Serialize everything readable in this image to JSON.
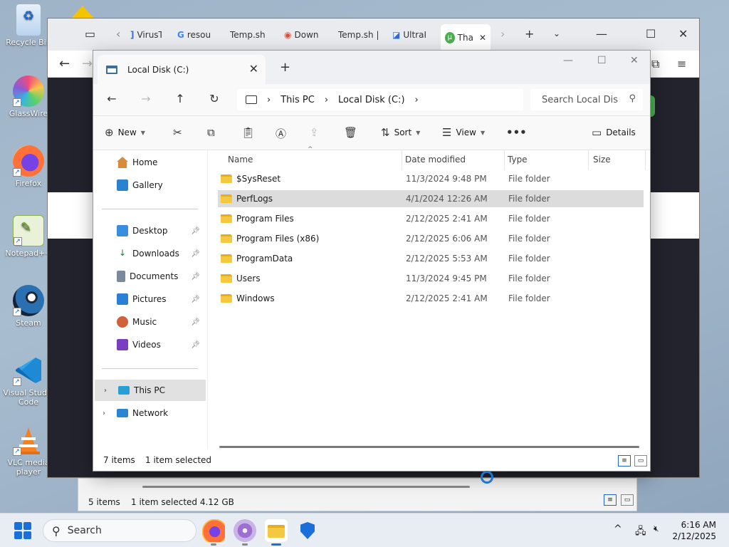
{
  "desktop": {
    "icons": [
      {
        "label": "Recycle Bin"
      },
      {
        "label": "GlassWire"
      },
      {
        "label": "Firefox"
      },
      {
        "label": "Notepad++"
      },
      {
        "label": "Steam"
      },
      {
        "label": "Visual Studio Code"
      },
      {
        "label": "VLC media player"
      }
    ]
  },
  "browser": {
    "tabs": [
      "VirusT",
      "resou",
      "Temp.sh |",
      "Down",
      "Temp.sh |",
      "UltraI",
      "Tha"
    ]
  },
  "back_explorer": {
    "items": "5 items",
    "selected": "1 item selected  4.12 GB"
  },
  "explorer": {
    "tab_title": "Local Disk (C:)",
    "breadcrumb": [
      "This PC",
      "Local Disk (C:)"
    ],
    "search_placeholder": "Search Local Dis",
    "commands": {
      "new": "New",
      "sort": "Sort",
      "view": "View",
      "details": "Details"
    },
    "sidebar": {
      "home": "Home",
      "gallery": "Gallery",
      "desktop": "Desktop",
      "downloads": "Downloads",
      "documents": "Documents",
      "pictures": "Pictures",
      "music": "Music",
      "videos": "Videos",
      "this_pc": "This PC",
      "network": "Network"
    },
    "columns": {
      "name": "Name",
      "date": "Date modified",
      "type": "Type",
      "size": "Size"
    },
    "files": [
      {
        "name": "$SysReset",
        "date": "11/3/2024 9:48 PM",
        "type": "File folder"
      },
      {
        "name": "PerfLogs",
        "date": "4/1/2024 12:26 AM",
        "type": "File folder"
      },
      {
        "name": "Program Files",
        "date": "2/12/2025 2:41 AM",
        "type": "File folder"
      },
      {
        "name": "Program Files (x86)",
        "date": "2/12/2025 6:06 AM",
        "type": "File folder"
      },
      {
        "name": "ProgramData",
        "date": "2/12/2025 5:53 AM",
        "type": "File folder"
      },
      {
        "name": "Users",
        "date": "11/3/2024 9:45 PM",
        "type": "File folder"
      },
      {
        "name": "Windows",
        "date": "2/12/2025 2:41 AM",
        "type": "File folder"
      }
    ],
    "status": {
      "count": "7 items",
      "selected": "1 item selected"
    }
  },
  "taskbar": {
    "search": "Search",
    "time": "6:16 AM",
    "date": "2/12/2025"
  }
}
